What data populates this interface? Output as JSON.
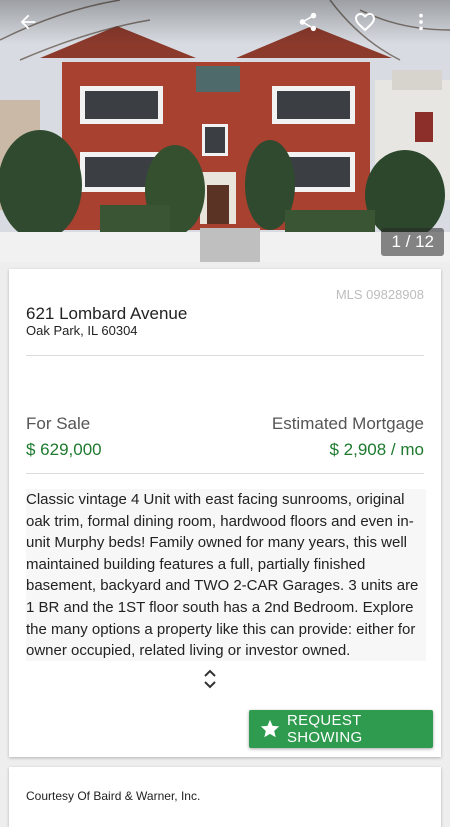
{
  "gallery": {
    "counter": "1 / 12"
  },
  "listing": {
    "mls": "MLS 09828908",
    "address": "621 Lombard Avenue",
    "city_state_zip": "Oak Park, IL 60304",
    "status_label": "For Sale",
    "price": "$ 629,000",
    "mortgage_label": "Estimated Mortgage",
    "mortgage_value": "$ 2,908 / mo",
    "description": "Classic vintage 4 Unit with east facing sunrooms, original oak trim, formal dining room, hardwood floors and even in-unit Murphy beds! Family owned for many years, this well maintained building features a full, partially finished basement, backyard and TWO 2-CAR Garages. 3 units are 1 BR and the 1ST floor south has a 2nd Bedroom. Explore the many options a property like this can provide: either for owner occupied, related living or investor owned."
  },
  "actions": {
    "request_label": "REQUEST SHOWING"
  },
  "footer": {
    "courtesy": "Courtesy Of Baird & Warner, Inc."
  },
  "icons": {
    "back": "arrow-back-icon",
    "share": "share-icon",
    "favorite": "heart-outline-icon",
    "more": "more-vert-icon",
    "expand": "expand-chevrons-icon",
    "request": "star-icon"
  },
  "colors": {
    "accent": "#2e9b4e",
    "price": "#1e7a2e"
  }
}
